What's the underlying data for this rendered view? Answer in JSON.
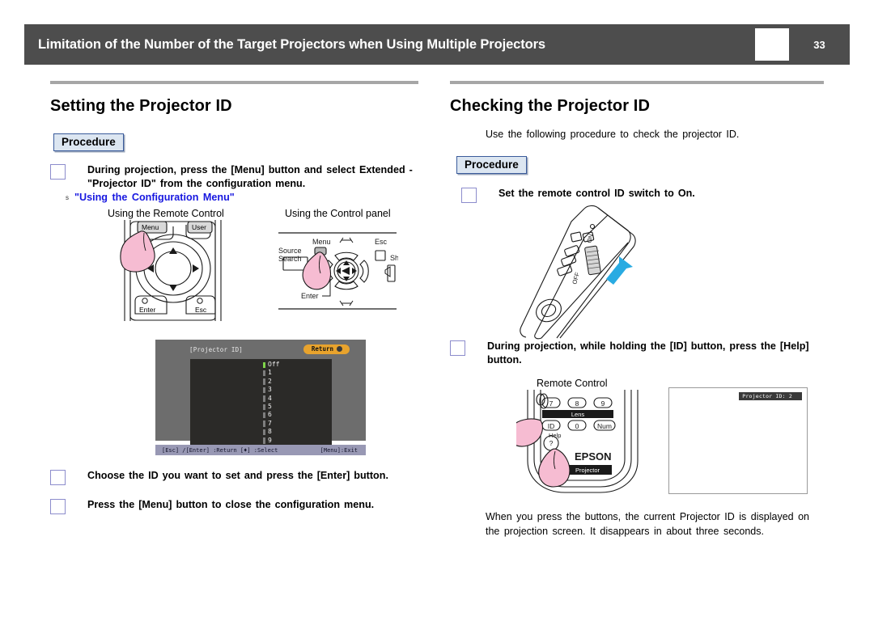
{
  "header": {
    "title": "Limitation of the Number of the Target Projectors when Using Multiple Projectors",
    "page_number": "33",
    "bar_color": "#4d4d4d"
  },
  "left_column": {
    "section_title": "Setting the Projector ID",
    "procedure_label": "Procedure",
    "steps": [
      {
        "text": "During projection, press the [Menu] button and select Extended - \"Projector ID\" from the configuration menu.",
        "link_arrow": "s",
        "link_text": "\"Using the Configuration Menu\""
      },
      {
        "text": "Choose the ID you want to set and press the [Enter] button."
      },
      {
        "text": "Press the [Menu] button to close the configuration menu."
      }
    ],
    "figures": {
      "remote_caption": "Using the Remote Control",
      "panel_caption": "Using the Control panel",
      "remote_labels": [
        "Menu",
        "User",
        "Enter",
        "Esc"
      ],
      "panel_labels": [
        "Menu",
        "Esc",
        "Source",
        "Search",
        "Sh",
        "Enter"
      ]
    },
    "osd": {
      "title": "[Projector ID]",
      "return_label": "Return",
      "items": [
        "Off",
        "1",
        "2",
        "3",
        "4",
        "5",
        "6",
        "7",
        "8",
        "9"
      ],
      "selected_index": 0,
      "footer_left": "[Esc] /[Enter] :Return [♦] :Select",
      "footer_right": "[Menu]:Exit",
      "accent_color": "#e8a32d",
      "selected_bar_color": "#7fd44a"
    }
  },
  "right_column": {
    "section_title": "Checking the Projector ID",
    "intro": "Use the following procedure to check the projector ID.",
    "procedure_label": "Procedure",
    "steps": [
      {
        "text": "Set the remote control ID switch to On."
      },
      {
        "text": "During projection, while holding the [ID] button, press the [Help] button."
      }
    ],
    "switch_labels": [
      "ON",
      "OFF"
    ],
    "remote_caption": "Remote Control",
    "remote_keys": [
      "7",
      "8",
      "9",
      "Lens",
      "ID",
      "0",
      "Num",
      "Help",
      "?"
    ],
    "brand": "EPSON",
    "brand_sub": "Projector",
    "screen_osd": "Projector ID: 2",
    "closing_text": "When you press the buttons, the current Projector ID is displayed on the projection screen. It disappears in about three seconds."
  }
}
